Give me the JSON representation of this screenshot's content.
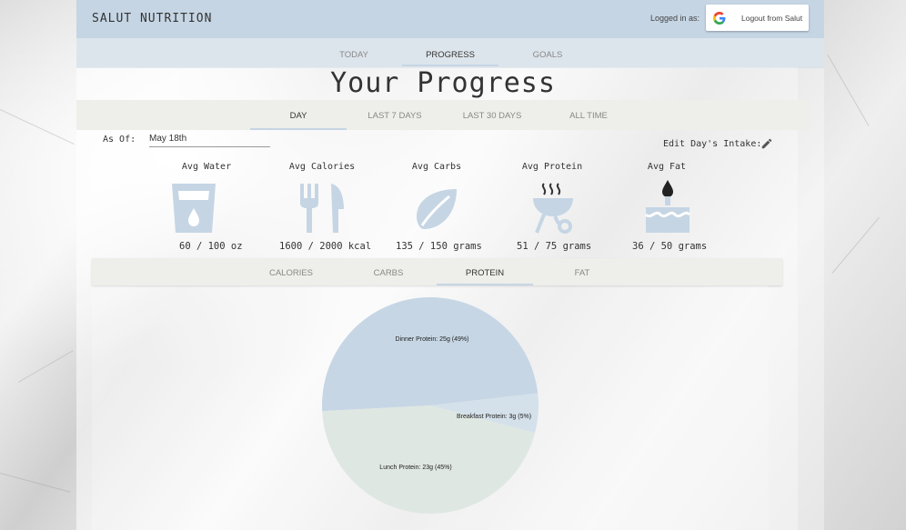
{
  "navbar": {
    "brand": "SALUT NUTRITION",
    "logged_in_label": "Logged in as:",
    "logout_label": "Logout from Salut",
    "tabs": [
      {
        "label": "TODAY"
      },
      {
        "label": "PROGRESS",
        "active": true
      },
      {
        "label": "GOALS"
      }
    ]
  },
  "page": {
    "title": "Your Progress",
    "range_tabs": [
      {
        "label": "DAY",
        "active": true
      },
      {
        "label": "LAST 7 DAYS"
      },
      {
        "label": "LAST 30 DAYS"
      },
      {
        "label": "ALL TIME"
      }
    ],
    "as_of_label": "As Of:",
    "as_of_value": "May 18th",
    "edit_label": "Edit Day's Intake:"
  },
  "stats": [
    {
      "label": "Avg Water",
      "value": "60 / 100 oz",
      "icon": "water-glass-icon"
    },
    {
      "label": "Avg Calories",
      "value": "1600 / 2000 kcal",
      "icon": "fork-knife-icon"
    },
    {
      "label": "Avg Carbs",
      "value": "135 / 150 grams",
      "icon": "leaf-icon"
    },
    {
      "label": "Avg Protein",
      "value": "51 / 75 grams",
      "icon": "grill-icon"
    },
    {
      "label": "Avg Fat",
      "value": "36 / 50 grams",
      "icon": "cake-icon"
    }
  ],
  "nutrient_tabs": [
    {
      "label": "CALORIES"
    },
    {
      "label": "CARBS"
    },
    {
      "label": "PROTEIN",
      "active": true
    },
    {
      "label": "FAT"
    }
  ],
  "colors": {
    "accent": "#c5d5e4",
    "icon": "#c5d5e4",
    "pie_dinner": "#c6d6e5",
    "pie_breakfast": "#d4e1ea",
    "pie_lunch": "#dfe7e3"
  },
  "chart_data": {
    "type": "pie",
    "slices": [
      {
        "label": "Dinner Protein: 25g (49%)",
        "value": 25,
        "percent": 49
      },
      {
        "label": "Breakfast Protein: 3g (5%)",
        "value": 3,
        "percent": 5
      },
      {
        "label": "Lunch Protein: 23g (45%)",
        "value": 23,
        "percent": 45
      }
    ]
  }
}
